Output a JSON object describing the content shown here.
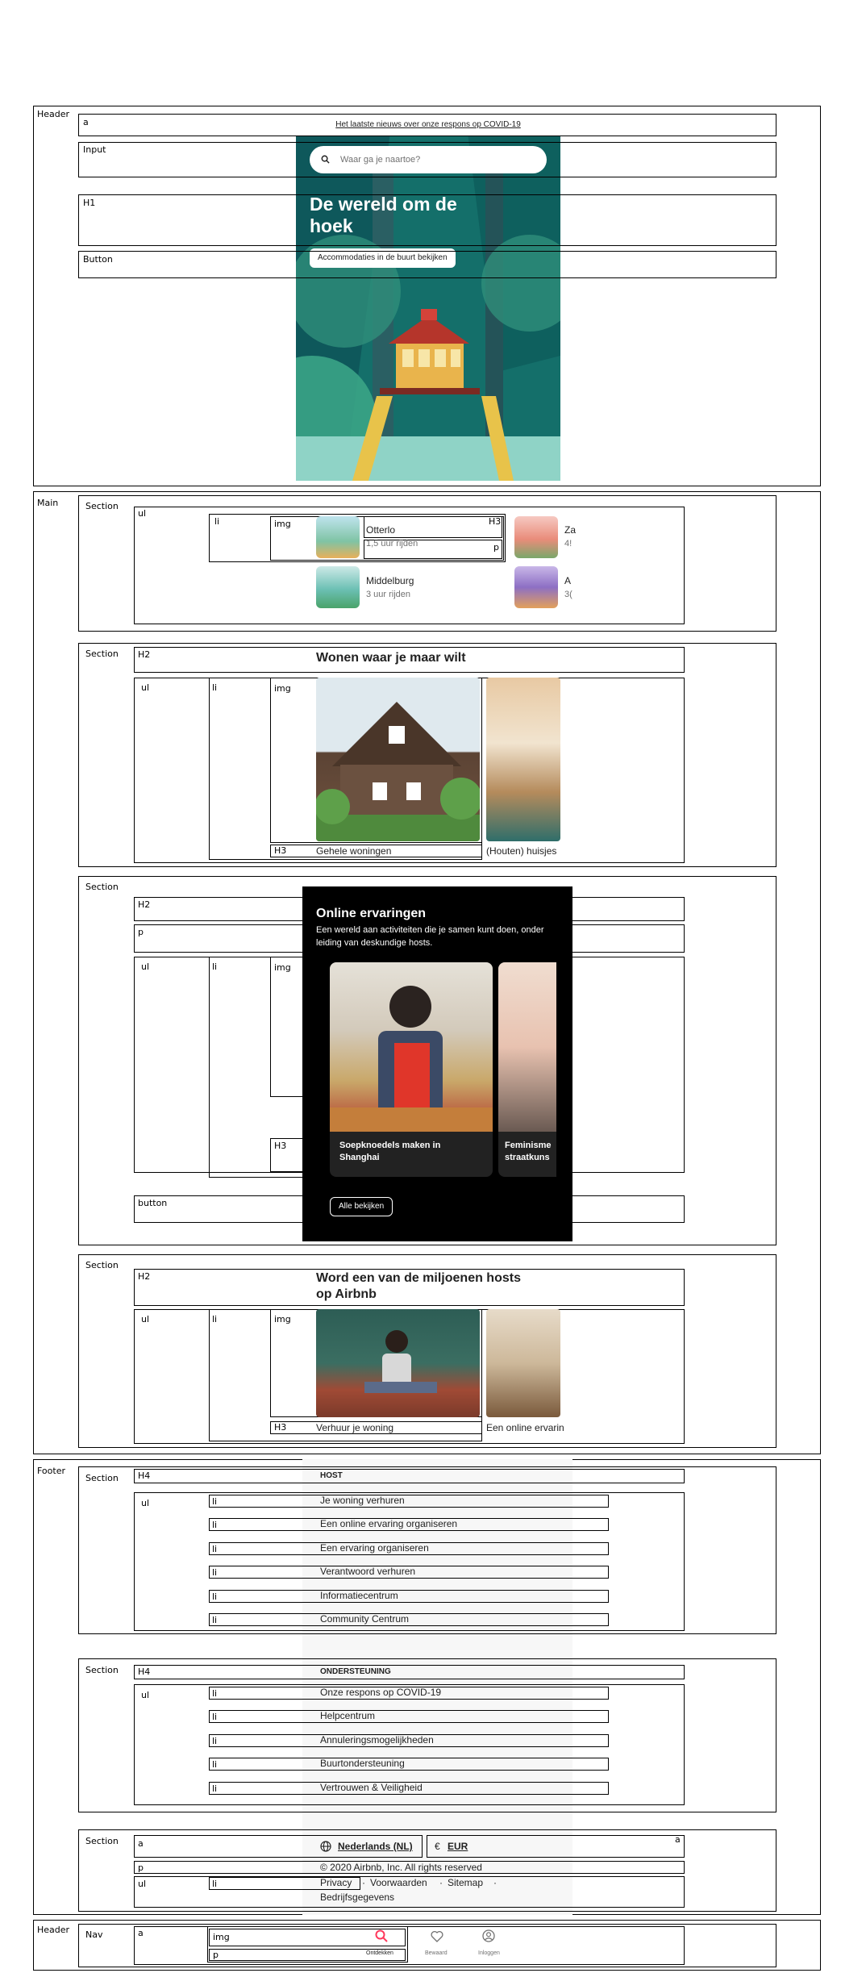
{
  "outline": {
    "header": "Header",
    "main": "Main",
    "footer": "Footer",
    "bottom_header": "Header",
    "a": "a",
    "input": "Input",
    "h1": "H1",
    "button": "Button",
    "section": "Section",
    "ul": "ul",
    "li": "li",
    "img": "img",
    "h2": "H2",
    "h3": "H3",
    "h4": "H4",
    "p": "p",
    "nav": "Nav",
    "button_lower": "button"
  },
  "hero": {
    "banner": "Het laatste nieuws over onze respons op COVID-19",
    "search_placeholder": "Waar ga je naartoe?",
    "title": "De wereld om de hoek",
    "cta": "Accommodaties in de buurt bekijken"
  },
  "nearby": [
    {
      "name": "Otterlo",
      "time": "1,5 uur rijden"
    },
    {
      "name": "Middelburg",
      "time": "3 uur rijden"
    },
    {
      "name": "Za",
      "time": "4!"
    },
    {
      "name": "A",
      "time": "3("
    }
  ],
  "wonen": {
    "title": "Wonen waar je maar wilt",
    "cards": [
      "Gehele woningen",
      "(Houten) huisjes"
    ]
  },
  "online": {
    "title": "Online ervaringen",
    "description": "Een wereld aan activiteiten die je samen kunt doen, onder leiding van deskundige hosts.",
    "cards": [
      "Soepknoedels maken in Shanghai",
      "Feminisme straatkuns"
    ],
    "button": "Alle bekijken"
  },
  "host_section": {
    "title": "Word een van de miljoenen hosts op Airbnb",
    "cards": [
      "Verhuur je woning",
      "Een online ervarin"
    ]
  },
  "footer": {
    "host_heading": "HOST",
    "host_links": [
      "Je woning verhuren",
      "Een online ervaring organiseren",
      "Een ervaring organiseren",
      "Verantwoord verhuren",
      "Informatiecentrum",
      "Community Centrum"
    ],
    "support_heading": "ONDERSTEUNING",
    "support_links": [
      "Onze respons op COVID-19",
      "Helpcentrum",
      "Annuleringsmogelijkheden",
      "Buurtondersteuning",
      "Vertrouwen & Veiligheid"
    ],
    "language": "Nederlands (NL)",
    "currency_symbol": "€",
    "currency": "EUR",
    "copyright": "© 2020 Airbnb, Inc. All rights reserved",
    "legal_links": [
      "Privacy",
      "Voorwaarden",
      "Sitemap",
      "Bedrijfsgegevens"
    ],
    "separator": "·"
  },
  "bottom_nav": {
    "items": [
      {
        "label": "Ontdekken",
        "icon": "search-icon",
        "active": true
      },
      {
        "label": "Bewaard",
        "icon": "heart-icon",
        "active": false
      },
      {
        "label": "Inloggen",
        "icon": "user-icon",
        "active": false
      }
    ],
    "accent": "#FF385C"
  },
  "colors": {
    "accent": "#FF385C",
    "online_bg": "#000000"
  }
}
